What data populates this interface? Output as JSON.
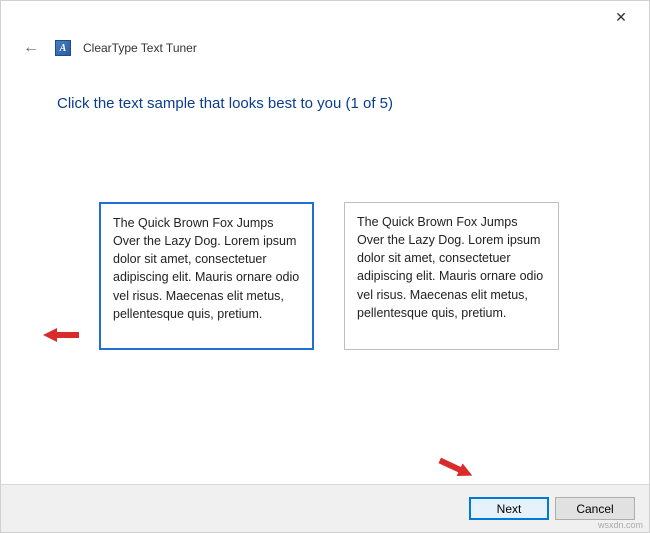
{
  "window": {
    "close_glyph": "✕",
    "back_glyph": "←",
    "icon_letter": "A",
    "title": "ClearType Text Tuner"
  },
  "page": {
    "heading": "Click the text sample that looks best to you (1 of 5)"
  },
  "samples": {
    "left": "The Quick Brown Fox Jumps Over the Lazy Dog. Lorem ipsum dolor sit amet, consectetuer adipiscing elit. Mauris ornare odio vel risus. Maecenas elit metus, pellentesque quis, pretium.",
    "right": "The Quick Brown Fox Jumps Over the Lazy Dog. Lorem ipsum dolor sit amet, consectetuer adipiscing elit. Mauris ornare odio vel risus. Maecenas elit metus, pellentesque quis, pretium."
  },
  "footer": {
    "next_label": "Next",
    "cancel_label": "Cancel"
  },
  "watermark": "wsxdn.com"
}
